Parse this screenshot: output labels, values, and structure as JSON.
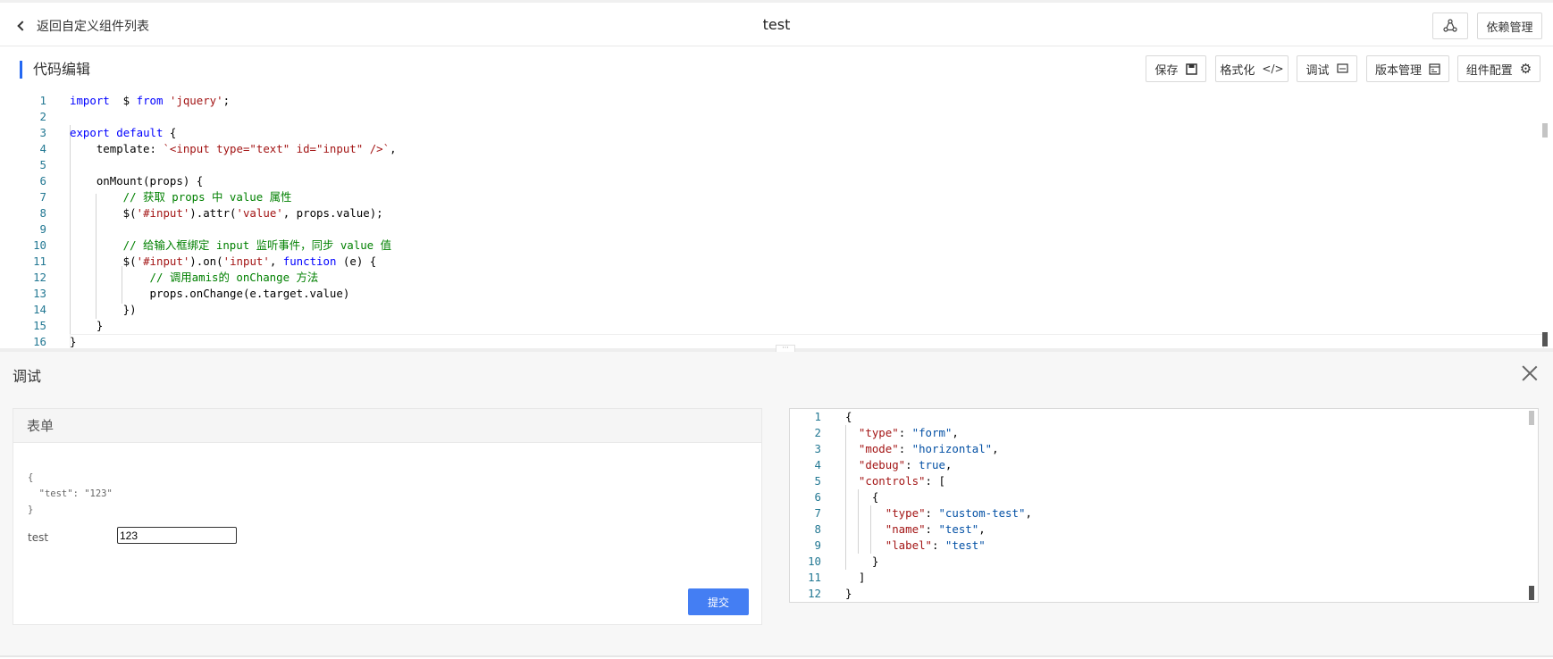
{
  "topbar": {
    "back_label": "返回自定义组件列表",
    "title": "test",
    "icon_button": "share-icon",
    "dependency_label": "依赖管理"
  },
  "section": {
    "title": "代码编辑",
    "actions": [
      {
        "label": "保存",
        "icon": "save-icon",
        "glyph": "▣"
      },
      {
        "label": "格式化",
        "icon": "code-icon",
        "glyph": "</>"
      },
      {
        "label": "调试",
        "icon": "debug-icon",
        "glyph": "▭"
      },
      {
        "label": "版本管理",
        "icon": "version-icon",
        "glyph": "▤"
      },
      {
        "label": "组件配置",
        "icon": "gear-icon",
        "glyph": "⚙"
      }
    ]
  },
  "code_editor": {
    "lines": [
      [
        [
          "kw",
          "import"
        ],
        [
          "",
          "  $ "
        ],
        [
          "kw",
          "from"
        ],
        [
          "",
          ""
        ],
        [
          "str",
          " 'jquery'"
        ],
        [
          "",
          ";"
        ]
      ],
      [],
      [
        [
          "kw",
          "export"
        ],
        [
          "",
          " "
        ],
        [
          "kw",
          "default"
        ],
        [
          "",
          " {"
        ]
      ],
      [
        [
          "",
          "    template: "
        ],
        [
          "str",
          "`<input type=\"text\" id=\"input\" />`"
        ],
        [
          "",
          ","
        ]
      ],
      [],
      [
        [
          "",
          "    onMount(props) {"
        ]
      ],
      [
        [
          "cm",
          "        // 获取 props 中 value 属性"
        ]
      ],
      [
        [
          "",
          "        $("
        ],
        [
          "str",
          "'#input'"
        ],
        [
          "",
          ").attr("
        ],
        [
          "str",
          "'value'"
        ],
        [
          "",
          ", props.value);"
        ]
      ],
      [],
      [
        [
          "cm",
          "        // 给输入框绑定 input 监听事件，同步 value 值"
        ]
      ],
      [
        [
          "",
          "        $("
        ],
        [
          "str",
          "'#input'"
        ],
        [
          "",
          ").on("
        ],
        [
          "str",
          "'input'"
        ],
        [
          "",
          ", "
        ],
        [
          "kw",
          "function"
        ],
        [
          "",
          " (e) {"
        ]
      ],
      [
        [
          "cm",
          "            // 调用amis的 onChange 方法"
        ]
      ],
      [
        [
          "",
          "            props.onChange(e.target.value)"
        ]
      ],
      [
        [
          "",
          "        })"
        ]
      ],
      [
        [
          "",
          "    }"
        ]
      ],
      [
        [
          "",
          "}"
        ]
      ]
    ]
  },
  "debug": {
    "title": "调试",
    "close_icon": "close-icon",
    "form_panel": {
      "title": "表单",
      "debug_json": "{\n  \"test\": \"123\"\n}",
      "field_label": "test",
      "field_value": "123",
      "submit_label": "提交"
    },
    "schema_lines": [
      [
        [
          "",
          "{"
        ]
      ],
      [
        [
          "",
          "  "
        ],
        [
          "jk",
          "\"type\""
        ],
        [
          "",
          ": "
        ],
        [
          "jv",
          "\"form\""
        ],
        [
          "",
          ","
        ]
      ],
      [
        [
          "",
          "  "
        ],
        [
          "jk",
          "\"mode\""
        ],
        [
          "",
          ": "
        ],
        [
          "jv",
          "\"horizontal\""
        ],
        [
          "",
          ","
        ]
      ],
      [
        [
          "",
          "  "
        ],
        [
          "jk",
          "\"debug\""
        ],
        [
          "",
          ": "
        ],
        [
          "jv",
          "true"
        ],
        [
          "",
          ","
        ]
      ],
      [
        [
          "",
          "  "
        ],
        [
          "jk",
          "\"controls\""
        ],
        [
          "",
          ": ["
        ]
      ],
      [
        [
          "",
          "    {"
        ]
      ],
      [
        [
          "",
          "      "
        ],
        [
          "jk",
          "\"type\""
        ],
        [
          "",
          ": "
        ],
        [
          "jv",
          "\"custom-test\""
        ],
        [
          "",
          ","
        ]
      ],
      [
        [
          "",
          "      "
        ],
        [
          "jk",
          "\"name\""
        ],
        [
          "",
          ": "
        ],
        [
          "jv",
          "\"test\""
        ],
        [
          "",
          ","
        ]
      ],
      [
        [
          "",
          "      "
        ],
        [
          "jk",
          "\"label\""
        ],
        [
          "",
          ": "
        ],
        [
          "jv",
          "\"test\""
        ]
      ],
      [
        [
          "",
          "    }"
        ]
      ],
      [
        [
          "",
          "  ]"
        ]
      ],
      [
        [
          "",
          "}"
        ]
      ]
    ]
  }
}
